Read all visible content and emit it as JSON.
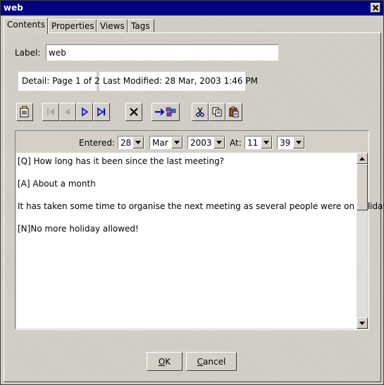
{
  "window": {
    "title": "web"
  },
  "tabs": [
    {
      "label": "Contents",
      "active": true
    },
    {
      "label": "Properties",
      "active": false
    },
    {
      "label": "Views",
      "active": false
    },
    {
      "label": "Tags",
      "active": false
    }
  ],
  "label_field": {
    "label": "Label:",
    "value": "web"
  },
  "detail": {
    "text": "Detail: Page 1 of 2"
  },
  "last_modified": {
    "text": "Last Modified: 28 Mar, 2003 1:46 PM"
  },
  "toolbar": {
    "icons": [
      "new-page-icon",
      "first-page-icon",
      "previous-page-icon",
      "next-page-icon",
      "last-page-icon",
      "delete-icon",
      "move-to-icon",
      "cut-icon",
      "copy-icon",
      "paste-icon"
    ]
  },
  "entered": {
    "label": "Entered:",
    "day": "28",
    "month": "Mar",
    "year": "2003",
    "at_label": "At:",
    "hour": "11",
    "minute": "39"
  },
  "content": {
    "lines": [
      "[Q] How long has it been since the last meeting?",
      "[A] About a month",
      "It has taken some time to organise the next meeting as several people were on holiday",
      "[N]No more holiday allowed!"
    ]
  },
  "buttons": {
    "ok": {
      "first": "O",
      "rest": "K"
    },
    "cancel": {
      "first": "C",
      "rest": "ancel"
    }
  },
  "colors": {
    "title_bar": "#000080",
    "face": "#d4d0c8",
    "arrow_blue": "#0000cc"
  }
}
